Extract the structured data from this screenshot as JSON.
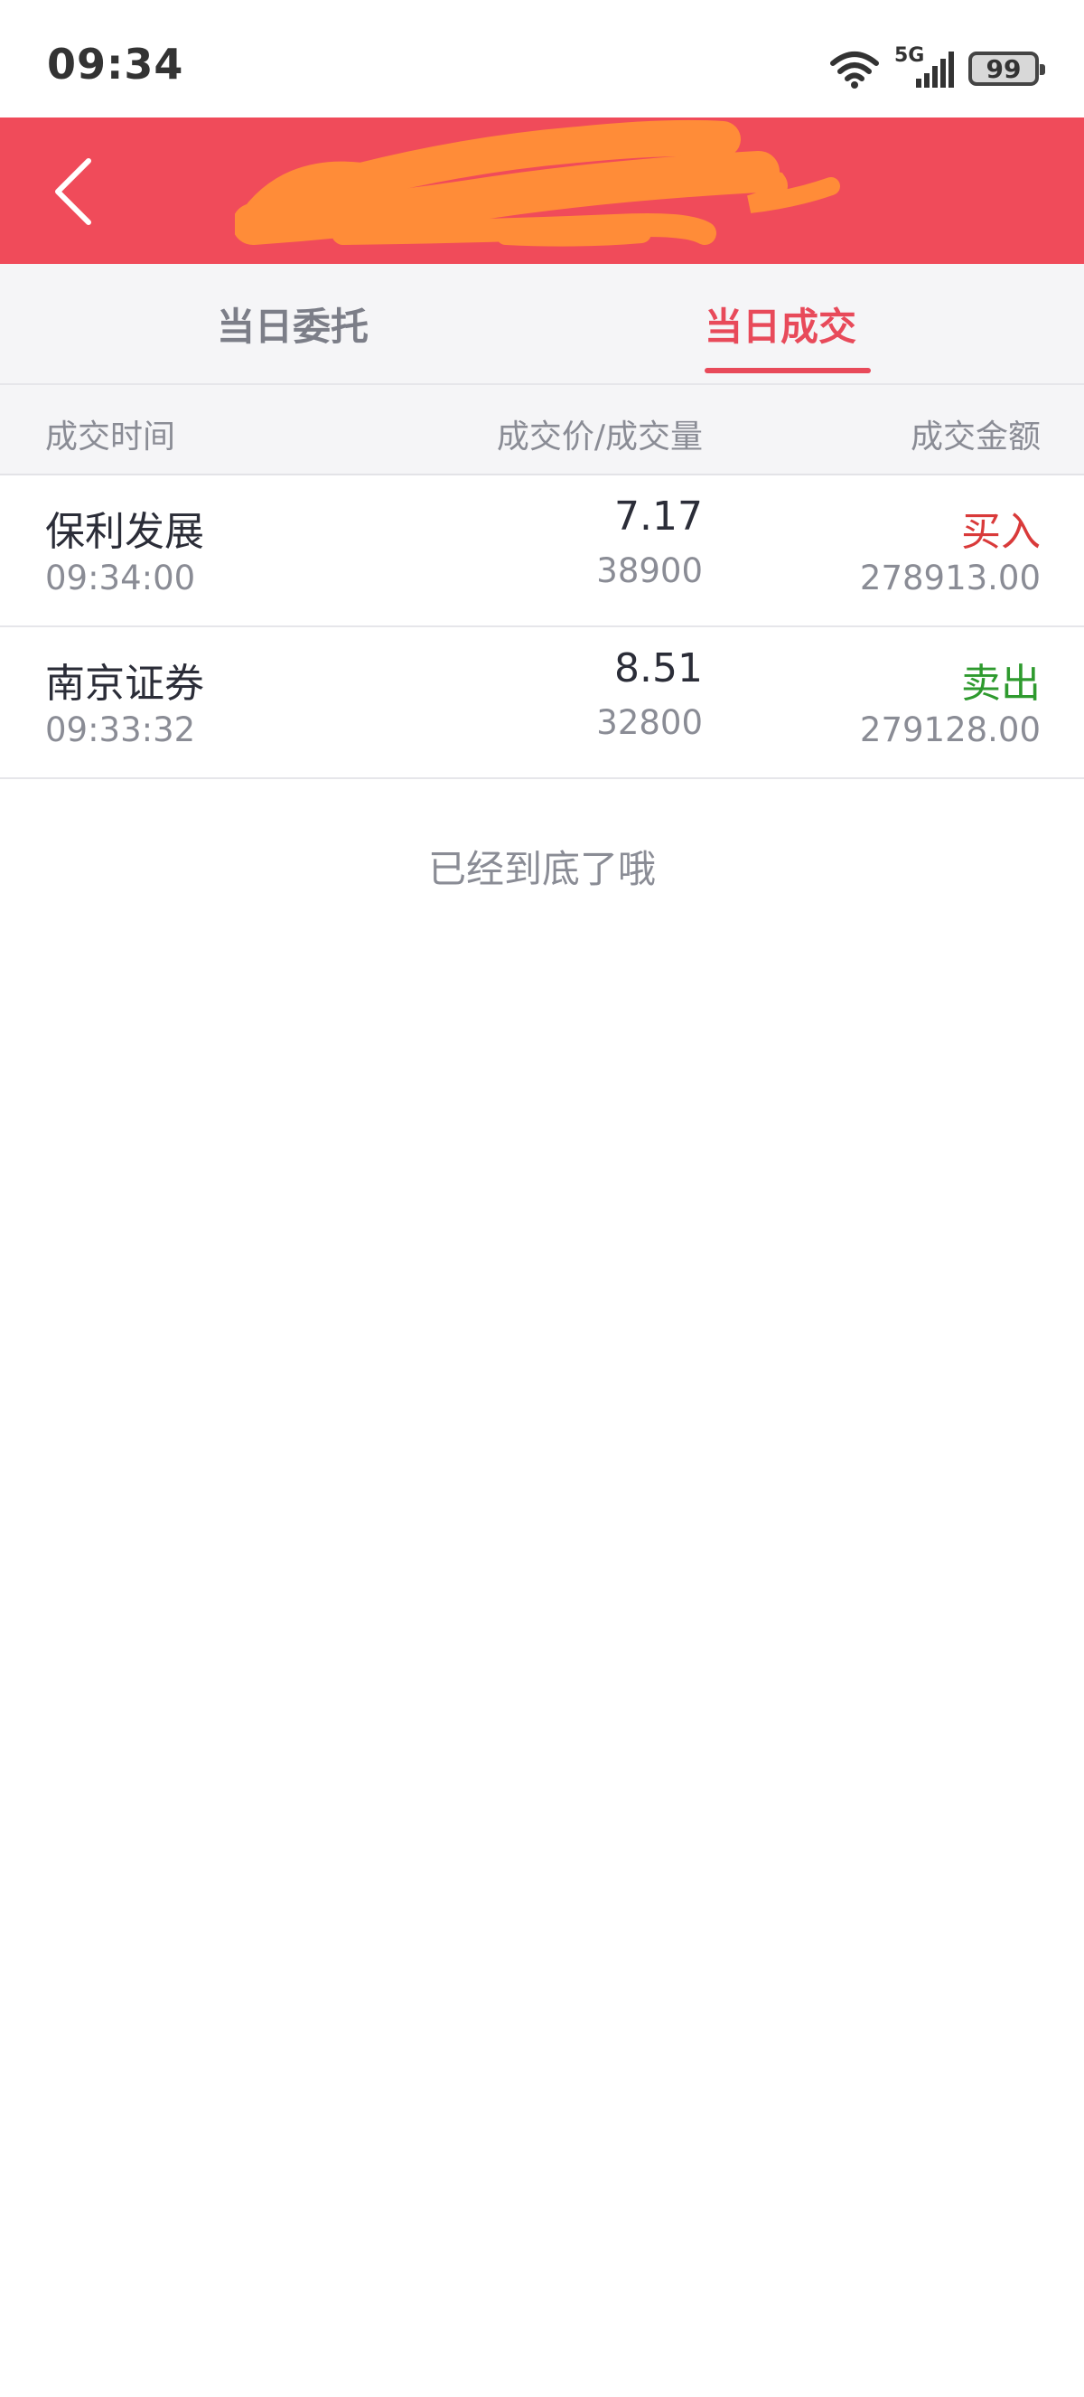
{
  "status_bar": {
    "time": "09:34",
    "network": "5G",
    "battery": "99"
  },
  "header": {
    "back_icon": "chevron-left-icon",
    "background_color": "#f04b5a"
  },
  "tabs": [
    {
      "label": "当日委托",
      "active": false
    },
    {
      "label": "当日成交",
      "active": true
    }
  ],
  "columns": {
    "time": "成交时间",
    "price_volume": "成交价/成交量",
    "amount": "成交金额"
  },
  "trades": [
    {
      "name": "保利发展",
      "time": "09:34:00",
      "price": "7.17",
      "volume": "38900",
      "direction": "买入",
      "amount": "278913.00"
    },
    {
      "name": "南京证券",
      "time": "09:33:32",
      "price": "8.51",
      "volume": "32800",
      "direction": "卖出",
      "amount": "279128.00"
    }
  ],
  "end_of_list": "已经到底了哦",
  "colors": {
    "accent": "#e84a5a",
    "buy": "#d93a3a",
    "sell": "#2e9a2e"
  }
}
